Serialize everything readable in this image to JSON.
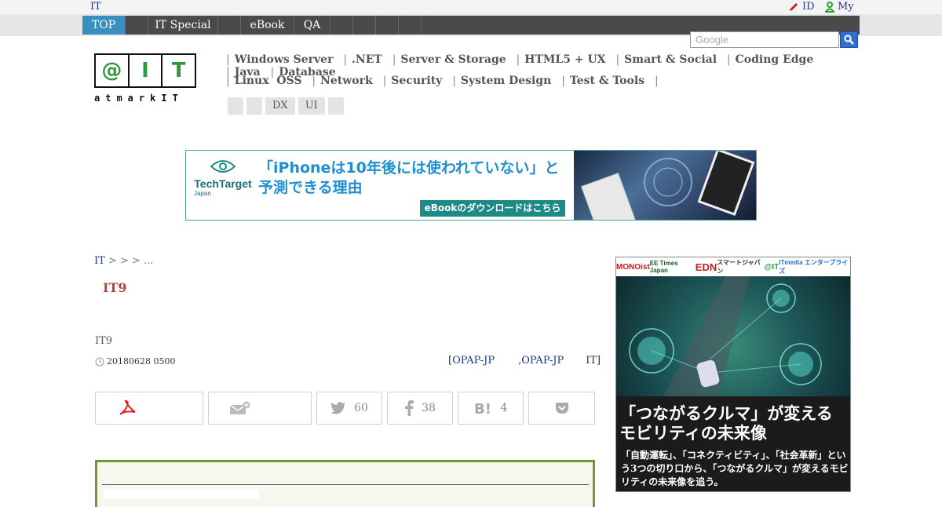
{
  "topbar": {
    "site_label": "IT",
    "id_label": "ID",
    "my_label": "My"
  },
  "nav": {
    "items": [
      {
        "label": "TOP",
        "active": true
      },
      {
        "label": ""
      },
      {
        "label": "IT Special"
      },
      {
        "label": ""
      },
      {
        "label": "eBook"
      },
      {
        "label": "QA"
      },
      {
        "label": ""
      },
      {
        "label": ""
      },
      {
        "label": ""
      },
      {
        "label": ""
      }
    ],
    "search_placeholder": "Google",
    "search_icon": "magnifier-icon"
  },
  "logo": {
    "chars": [
      "@",
      "I",
      "T"
    ],
    "subtitle": "atmarkIT"
  },
  "categories": {
    "row1": [
      "Windows Server",
      ".NET",
      "Server & Storage",
      "HTML5 + UX",
      "Smart & Social",
      "Coding Edge",
      "Java",
      "Database"
    ],
    "row2": [
      "Linux  OSS",
      "Network",
      "Security",
      "System Design",
      "Test & Tools"
    ]
  },
  "tags": [
    "",
    "",
    "DX",
    "UI",
    ""
  ],
  "banner": {
    "brand": "TechTarget",
    "brand_sub": "Japan",
    "headline_line1": "「iPhoneは10年後には使われていない」と",
    "headline_line2": "予測できる理由",
    "cta": "eBookのダウンロードはこちら"
  },
  "breadcrumb": {
    "root": "IT",
    "rest": " >  >  > ..."
  },
  "article": {
    "title": "IT9",
    "byline": "IT9",
    "date": "20180628 0500",
    "source_open": "[",
    "source1": "OPAP-JP",
    "source_mid": ", ",
    "source2": "OPAP-JP",
    "source_close": "IT]"
  },
  "share": {
    "twitter_count": "60",
    "facebook_count": "38",
    "hatena_count": "4"
  },
  "side_ad": {
    "logos": [
      "MONOist",
      "EE Times Japan",
      "EDN",
      "スマートジャパン",
      "@IT",
      "ITmedia エンタープライズ"
    ],
    "headline_line1": "「つながるクルマ」が変える",
    "headline_line2": "モビリティの未来像",
    "body": "「自動運転」、「コネクティビティ」、「社会革新」という3つの切り口から、「つながるクルマ」が変えるモビリティの未来像を追う。"
  },
  "colors": {
    "nav_bg": "#4a4a4a",
    "nav_active": "#3b8fc0",
    "title": "#b0443a",
    "article_border": "#6c9a2e",
    "link": "#1a3a8a"
  }
}
